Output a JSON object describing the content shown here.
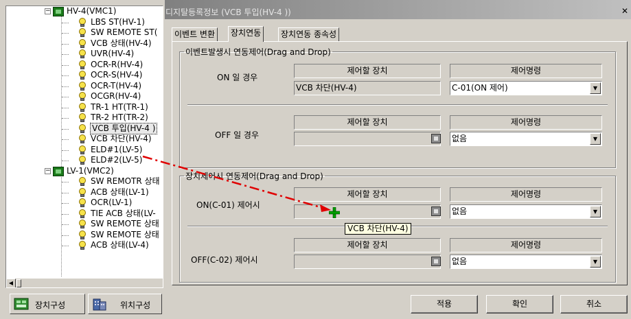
{
  "tree": {
    "items": [
      {
        "label": "HV-4(VMC1)",
        "type": "folder",
        "indent": 0
      },
      {
        "label": "LBS ST(HV-1)",
        "type": "bulb",
        "indent": 1
      },
      {
        "label": "SW REMOTE ST(",
        "type": "bulb",
        "indent": 1
      },
      {
        "label": "VCB 상태(HV-4)",
        "type": "bulb",
        "indent": 1
      },
      {
        "label": "UVR(HV-4)",
        "type": "bulb",
        "indent": 1
      },
      {
        "label": "OCR-R(HV-4)",
        "type": "bulb",
        "indent": 1
      },
      {
        "label": "OCR-S(HV-4)",
        "type": "bulb",
        "indent": 1
      },
      {
        "label": "OCR-T(HV-4)",
        "type": "bulb",
        "indent": 1
      },
      {
        "label": "OCGR(HV-4)",
        "type": "bulb",
        "indent": 1
      },
      {
        "label": "TR-1 HT(TR-1)",
        "type": "bulb",
        "indent": 1
      },
      {
        "label": "TR-2 HT(TR-2)",
        "type": "bulb",
        "indent": 1
      },
      {
        "label": "VCB 투입(HV-4 )",
        "type": "bulb",
        "indent": 1,
        "selected": true
      },
      {
        "label": "VCB 차단(HV-4)",
        "type": "bulb",
        "indent": 1
      },
      {
        "label": "ELD#1(LV-5)",
        "type": "bulb",
        "indent": 1
      },
      {
        "label": "ELD#2(LV-5)",
        "type": "bulb",
        "indent": 1
      },
      {
        "label": "LV-1(VMC2)",
        "type": "folder",
        "indent": 0
      },
      {
        "label": "SW REMOTR 상태",
        "type": "bulb",
        "indent": 1
      },
      {
        "label": "ACB 상태(LV-1)",
        "type": "bulb",
        "indent": 1
      },
      {
        "label": "OCR(LV-1)",
        "type": "bulb",
        "indent": 1
      },
      {
        "label": "TIE ACB 상태(LV-",
        "type": "bulb",
        "indent": 1
      },
      {
        "label": "SW REMOTE 상태",
        "type": "bulb",
        "indent": 1
      },
      {
        "label": "SW REMOTE 상태",
        "type": "bulb",
        "indent": 1
      },
      {
        "label": "ACB 상태(LV-4)",
        "type": "bulb",
        "indent": 1
      }
    ],
    "expander_minus": "−",
    "scroll_left": "◀"
  },
  "bottom_tabs": {
    "device_config": "장치구성",
    "location_config": "위치구성"
  },
  "dialog": {
    "title": "디지탈등록정보 (VCB 투입(HV-4 ))",
    "close": "✕",
    "tabs": [
      "이벤트 변환",
      "장치연동",
      "장치연동 종속성"
    ],
    "active_tab": 1,
    "group1": {
      "legend": "이벤트발생시 연동제어(Drag and Drop)",
      "on_label": "ON 일 경우",
      "off_label": "OFF 일 경우",
      "device_header": "제어할 장치",
      "command_header": "제어명령",
      "on_device": "VCB 차단(HV-4)",
      "on_command": "C-01(ON 제어)",
      "off_device": "",
      "off_command": "없음"
    },
    "group2": {
      "legend": "장치제어시 연동제어(Drag and Drop)",
      "on_label": "ON(C-01) 제어시",
      "off_label": "OFF(C-02) 제어시",
      "device_header": "제어할 장치",
      "command_header": "제어명령",
      "on_device": "",
      "on_command": "없음",
      "off_device": "",
      "off_command": "없음"
    },
    "buttons": {
      "apply": "적용",
      "ok": "확인",
      "cancel": "취소"
    },
    "drag_tooltip": "VCB 차단(HV-4)",
    "combo_arrow": "▼"
  },
  "colors": {
    "face": "#d4d0c8",
    "drag_arrow": "#e00000",
    "plus_cursor": "#00a000",
    "tooltip_bg": "#ffffe1"
  }
}
